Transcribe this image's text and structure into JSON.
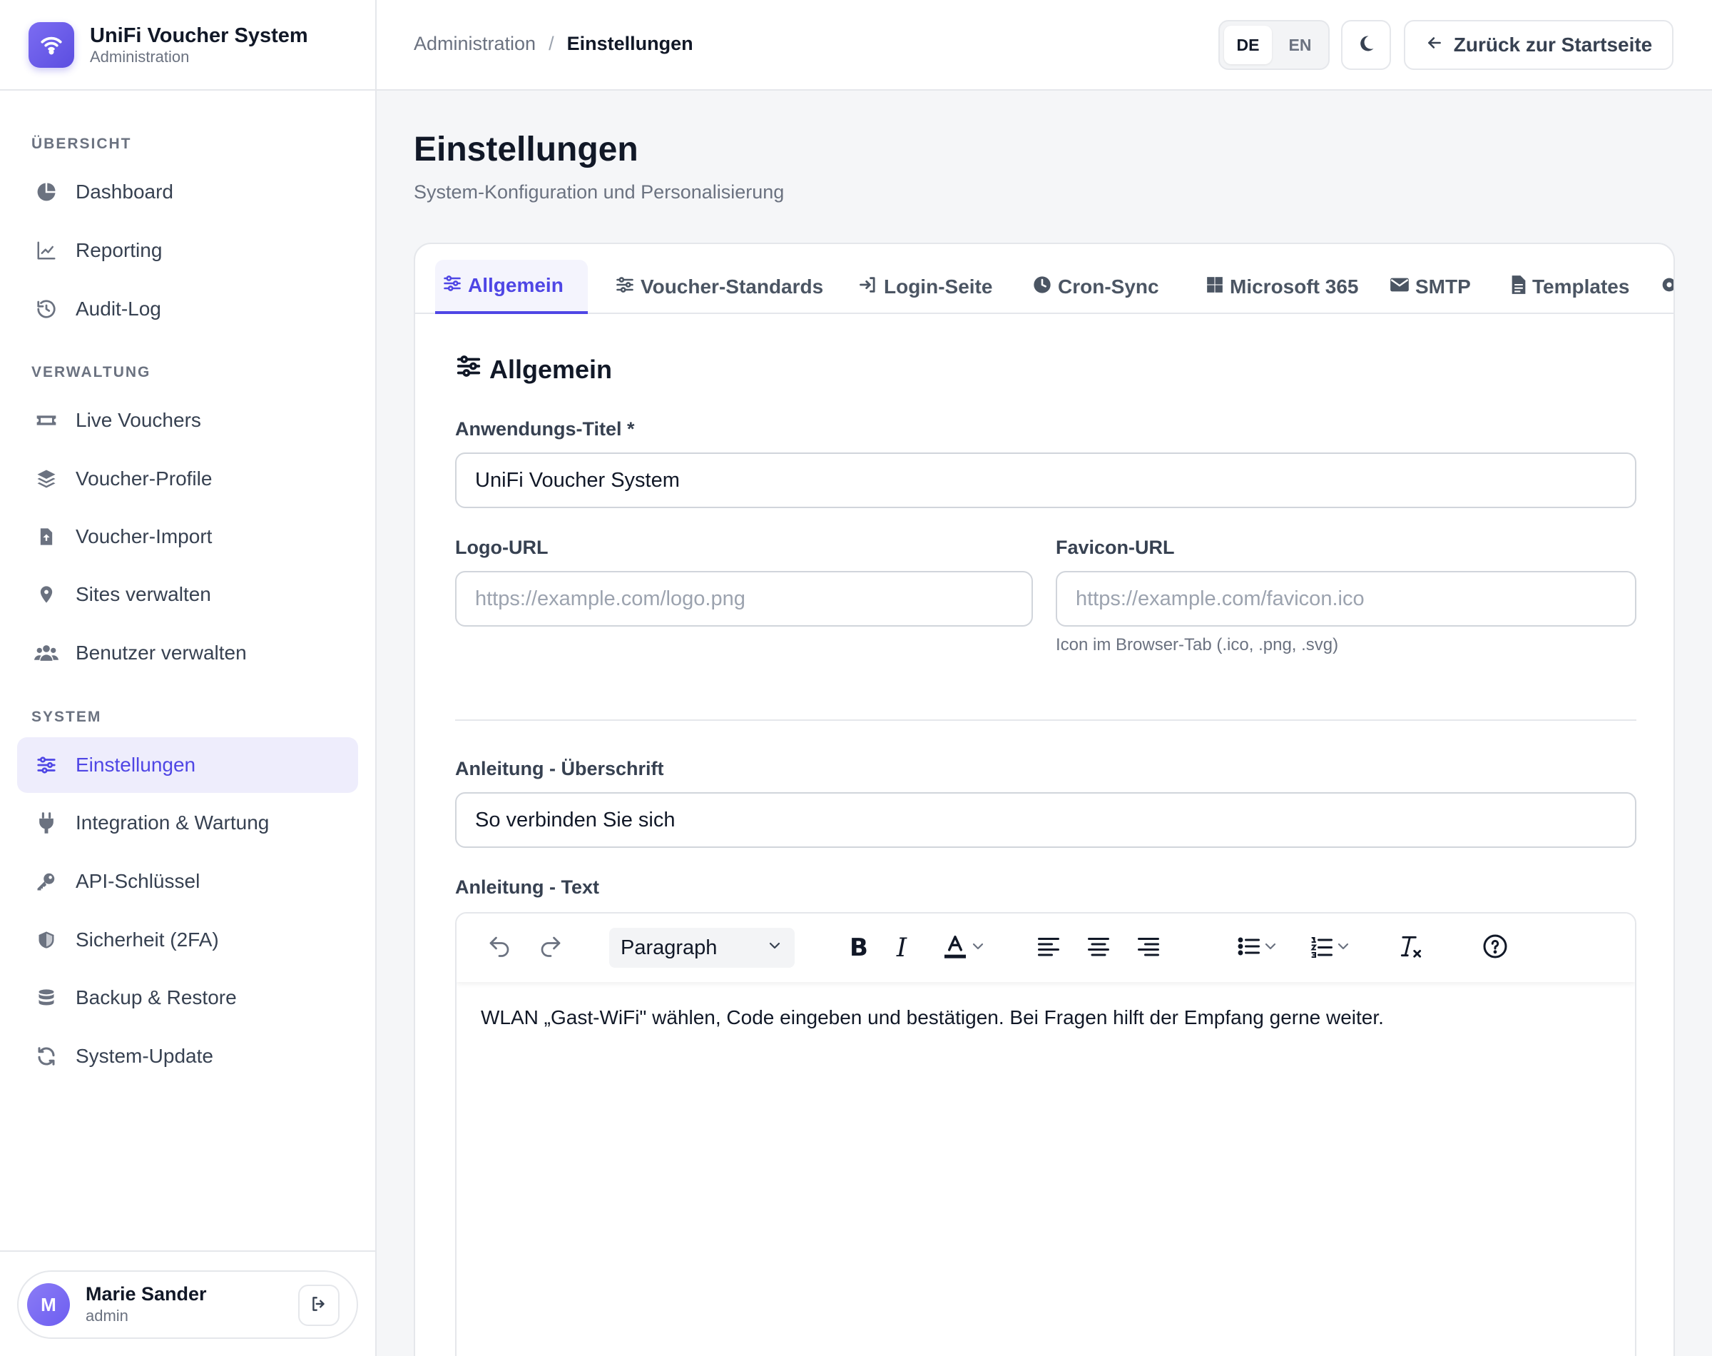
{
  "brand": {
    "title": "UniFi Voucher System",
    "subtitle": "Administration"
  },
  "sidebar": {
    "sections": [
      {
        "title": "ÜBERSICHT",
        "items": [
          {
            "label": "Dashboard",
            "icon": "pie-chart-icon"
          },
          {
            "label": "Reporting",
            "icon": "line-chart-icon"
          },
          {
            "label": "Audit-Log",
            "icon": "history-icon"
          }
        ]
      },
      {
        "title": "VERWALTUNG",
        "items": [
          {
            "label": "Live Vouchers",
            "icon": "ticket-icon"
          },
          {
            "label": "Voucher-Profile",
            "icon": "layers-icon"
          },
          {
            "label": "Voucher-Import",
            "icon": "file-upload-icon"
          },
          {
            "label": "Sites verwalten",
            "icon": "map-pin-icon"
          },
          {
            "label": "Benutzer verwalten",
            "icon": "users-icon"
          }
        ]
      },
      {
        "title": "SYSTEM",
        "items": [
          {
            "label": "Einstellungen",
            "icon": "sliders-icon",
            "active": true
          },
          {
            "label": "Integration & Wartung",
            "icon": "plug-icon"
          },
          {
            "label": "API-Schlüssel",
            "icon": "key-icon"
          },
          {
            "label": "Sicherheit (2FA)",
            "icon": "shield-icon"
          },
          {
            "label": "Backup & Restore",
            "icon": "database-icon"
          },
          {
            "label": "System-Update",
            "icon": "refresh-icon"
          }
        ]
      }
    ]
  },
  "user": {
    "initial": "M",
    "name": "Marie Sander",
    "role": "admin"
  },
  "topbar": {
    "breadcrumb": [
      "Administration",
      "Einstellungen"
    ],
    "languages": [
      "DE",
      "EN"
    ],
    "active_language": "DE",
    "back_label": "Zurück zur Startseite"
  },
  "page": {
    "title": "Einstellungen",
    "subtitle": "System-Konfiguration und Personalisierung"
  },
  "tabs": [
    {
      "label": "Allgemein",
      "icon": "sliders-icon",
      "active": true
    },
    {
      "label": "Voucher-Standards",
      "icon": "sliders-icon"
    },
    {
      "label": "Login-Seite",
      "icon": "sign-in-icon"
    },
    {
      "label": "Cron-Sync",
      "icon": "clock-icon"
    },
    {
      "label": "Microsoft 365",
      "icon": "windows-icon"
    },
    {
      "label": "SMTP",
      "icon": "envelope-icon"
    },
    {
      "label": "Templates",
      "icon": "file-icon"
    }
  ],
  "form": {
    "section_title": "Allgemein",
    "app_title_label": "Anwendungs-Titel *",
    "app_title_value": "UniFi Voucher System",
    "logo_label": "Logo-URL",
    "logo_placeholder": "https://example.com/logo.png",
    "favicon_label": "Favicon-URL",
    "favicon_placeholder": "https://example.com/favicon.ico",
    "favicon_hint": "Icon im Browser-Tab (.ico, .png, .svg)",
    "guide_heading_label": "Anleitung - Überschrift",
    "guide_heading_value": "So verbinden Sie sich",
    "guide_text_label": "Anleitung - Text",
    "editor": {
      "block_format": "Paragraph",
      "content": "WLAN „Gast-WiFi\" wählen, Code eingeben und bestätigen. Bei Fragen hilft der Empfang gerne weiter."
    }
  },
  "colors": {
    "accent": "#4f46e5",
    "accent_bg": "#eeedfc"
  }
}
